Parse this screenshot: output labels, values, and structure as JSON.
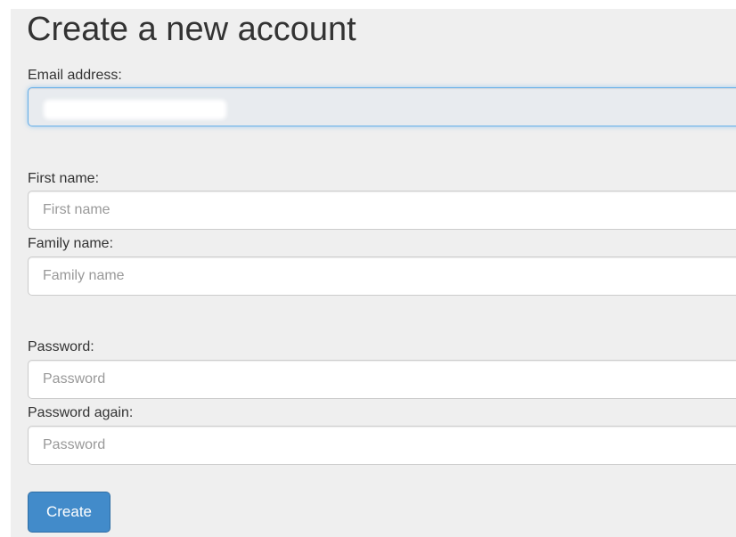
{
  "form": {
    "title": "Create a new account",
    "email": {
      "label": "Email address:",
      "value": ""
    },
    "first_name": {
      "label": "First name:",
      "placeholder": "First name"
    },
    "family_name": {
      "label": "Family name:",
      "placeholder": "Family name"
    },
    "password": {
      "label": "Password:",
      "placeholder": "Password"
    },
    "password_again": {
      "label": "Password again:",
      "placeholder": "Password"
    },
    "submit_label": "Create"
  },
  "colors": {
    "background": "#efefef",
    "button": "#428bca",
    "focus_border": "#66afe9"
  }
}
